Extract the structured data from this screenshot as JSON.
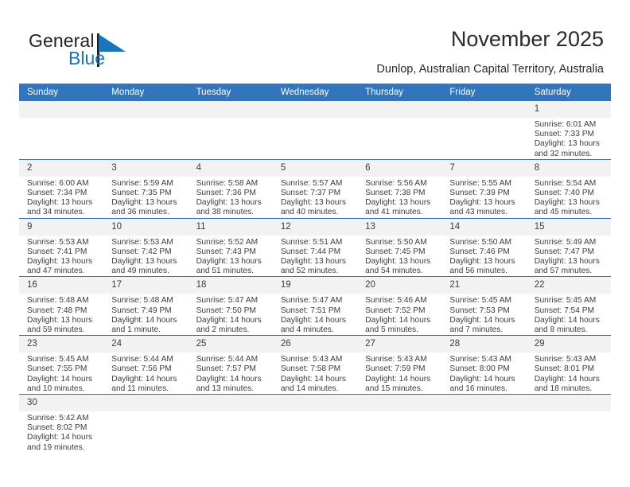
{
  "brand": {
    "name_top": "General",
    "name_bottom": "Blue",
    "logo_icon": "triangle-flag-icon",
    "accent_color": "#1b75bb"
  },
  "header": {
    "title": "November 2025",
    "subtitle": "Dunlop, Australian Capital Territory, Australia"
  },
  "theme": {
    "header_bg": "#3275bc",
    "header_text": "#ffffff",
    "daynum_bg": "#f2f2f2",
    "row_divider": "#3275bc"
  },
  "calendar": {
    "weekday_headers": [
      "Sunday",
      "Monday",
      "Tuesday",
      "Wednesday",
      "Thursday",
      "Friday",
      "Saturday"
    ],
    "weeks": [
      [
        {
          "empty": true
        },
        {
          "empty": true
        },
        {
          "empty": true
        },
        {
          "empty": true
        },
        {
          "empty": true
        },
        {
          "empty": true
        },
        {
          "day": "1",
          "sunrise": "Sunrise: 6:01 AM",
          "sunset": "Sunset: 7:33 PM",
          "daylight1": "Daylight: 13 hours",
          "daylight2": "and 32 minutes."
        }
      ],
      [
        {
          "day": "2",
          "sunrise": "Sunrise: 6:00 AM",
          "sunset": "Sunset: 7:34 PM",
          "daylight1": "Daylight: 13 hours",
          "daylight2": "and 34 minutes."
        },
        {
          "day": "3",
          "sunrise": "Sunrise: 5:59 AM",
          "sunset": "Sunset: 7:35 PM",
          "daylight1": "Daylight: 13 hours",
          "daylight2": "and 36 minutes."
        },
        {
          "day": "4",
          "sunrise": "Sunrise: 5:58 AM",
          "sunset": "Sunset: 7:36 PM",
          "daylight1": "Daylight: 13 hours",
          "daylight2": "and 38 minutes."
        },
        {
          "day": "5",
          "sunrise": "Sunrise: 5:57 AM",
          "sunset": "Sunset: 7:37 PM",
          "daylight1": "Daylight: 13 hours",
          "daylight2": "and 40 minutes."
        },
        {
          "day": "6",
          "sunrise": "Sunrise: 5:56 AM",
          "sunset": "Sunset: 7:38 PM",
          "daylight1": "Daylight: 13 hours",
          "daylight2": "and 41 minutes."
        },
        {
          "day": "7",
          "sunrise": "Sunrise: 5:55 AM",
          "sunset": "Sunset: 7:39 PM",
          "daylight1": "Daylight: 13 hours",
          "daylight2": "and 43 minutes."
        },
        {
          "day": "8",
          "sunrise": "Sunrise: 5:54 AM",
          "sunset": "Sunset: 7:40 PM",
          "daylight1": "Daylight: 13 hours",
          "daylight2": "and 45 minutes."
        }
      ],
      [
        {
          "day": "9",
          "sunrise": "Sunrise: 5:53 AM",
          "sunset": "Sunset: 7:41 PM",
          "daylight1": "Daylight: 13 hours",
          "daylight2": "and 47 minutes."
        },
        {
          "day": "10",
          "sunrise": "Sunrise: 5:53 AM",
          "sunset": "Sunset: 7:42 PM",
          "daylight1": "Daylight: 13 hours",
          "daylight2": "and 49 minutes."
        },
        {
          "day": "11",
          "sunrise": "Sunrise: 5:52 AM",
          "sunset": "Sunset: 7:43 PM",
          "daylight1": "Daylight: 13 hours",
          "daylight2": "and 51 minutes."
        },
        {
          "day": "12",
          "sunrise": "Sunrise: 5:51 AM",
          "sunset": "Sunset: 7:44 PM",
          "daylight1": "Daylight: 13 hours",
          "daylight2": "and 52 minutes."
        },
        {
          "day": "13",
          "sunrise": "Sunrise: 5:50 AM",
          "sunset": "Sunset: 7:45 PM",
          "daylight1": "Daylight: 13 hours",
          "daylight2": "and 54 minutes."
        },
        {
          "day": "14",
          "sunrise": "Sunrise: 5:50 AM",
          "sunset": "Sunset: 7:46 PM",
          "daylight1": "Daylight: 13 hours",
          "daylight2": "and 56 minutes."
        },
        {
          "day": "15",
          "sunrise": "Sunrise: 5:49 AM",
          "sunset": "Sunset: 7:47 PM",
          "daylight1": "Daylight: 13 hours",
          "daylight2": "and 57 minutes."
        }
      ],
      [
        {
          "day": "16",
          "sunrise": "Sunrise: 5:48 AM",
          "sunset": "Sunset: 7:48 PM",
          "daylight1": "Daylight: 13 hours",
          "daylight2": "and 59 minutes."
        },
        {
          "day": "17",
          "sunrise": "Sunrise: 5:48 AM",
          "sunset": "Sunset: 7:49 PM",
          "daylight1": "Daylight: 14 hours",
          "daylight2": "and 1 minute."
        },
        {
          "day": "18",
          "sunrise": "Sunrise: 5:47 AM",
          "sunset": "Sunset: 7:50 PM",
          "daylight1": "Daylight: 14 hours",
          "daylight2": "and 2 minutes."
        },
        {
          "day": "19",
          "sunrise": "Sunrise: 5:47 AM",
          "sunset": "Sunset: 7:51 PM",
          "daylight1": "Daylight: 14 hours",
          "daylight2": "and 4 minutes."
        },
        {
          "day": "20",
          "sunrise": "Sunrise: 5:46 AM",
          "sunset": "Sunset: 7:52 PM",
          "daylight1": "Daylight: 14 hours",
          "daylight2": "and 5 minutes."
        },
        {
          "day": "21",
          "sunrise": "Sunrise: 5:45 AM",
          "sunset": "Sunset: 7:53 PM",
          "daylight1": "Daylight: 14 hours",
          "daylight2": "and 7 minutes."
        },
        {
          "day": "22",
          "sunrise": "Sunrise: 5:45 AM",
          "sunset": "Sunset: 7:54 PM",
          "daylight1": "Daylight: 14 hours",
          "daylight2": "and 8 minutes."
        }
      ],
      [
        {
          "day": "23",
          "sunrise": "Sunrise: 5:45 AM",
          "sunset": "Sunset: 7:55 PM",
          "daylight1": "Daylight: 14 hours",
          "daylight2": "and 10 minutes."
        },
        {
          "day": "24",
          "sunrise": "Sunrise: 5:44 AM",
          "sunset": "Sunset: 7:56 PM",
          "daylight1": "Daylight: 14 hours",
          "daylight2": "and 11 minutes."
        },
        {
          "day": "25",
          "sunrise": "Sunrise: 5:44 AM",
          "sunset": "Sunset: 7:57 PM",
          "daylight1": "Daylight: 14 hours",
          "daylight2": "and 13 minutes."
        },
        {
          "day": "26",
          "sunrise": "Sunrise: 5:43 AM",
          "sunset": "Sunset: 7:58 PM",
          "daylight1": "Daylight: 14 hours",
          "daylight2": "and 14 minutes."
        },
        {
          "day": "27",
          "sunrise": "Sunrise: 5:43 AM",
          "sunset": "Sunset: 7:59 PM",
          "daylight1": "Daylight: 14 hours",
          "daylight2": "and 15 minutes."
        },
        {
          "day": "28",
          "sunrise": "Sunrise: 5:43 AM",
          "sunset": "Sunset: 8:00 PM",
          "daylight1": "Daylight: 14 hours",
          "daylight2": "and 16 minutes."
        },
        {
          "day": "29",
          "sunrise": "Sunrise: 5:43 AM",
          "sunset": "Sunset: 8:01 PM",
          "daylight1": "Daylight: 14 hours",
          "daylight2": "and 18 minutes."
        }
      ],
      [
        {
          "day": "30",
          "sunrise": "Sunrise: 5:42 AM",
          "sunset": "Sunset: 8:02 PM",
          "daylight1": "Daylight: 14 hours",
          "daylight2": "and 19 minutes."
        },
        {
          "empty": true
        },
        {
          "empty": true
        },
        {
          "empty": true
        },
        {
          "empty": true
        },
        {
          "empty": true
        },
        {
          "empty": true
        }
      ]
    ]
  }
}
